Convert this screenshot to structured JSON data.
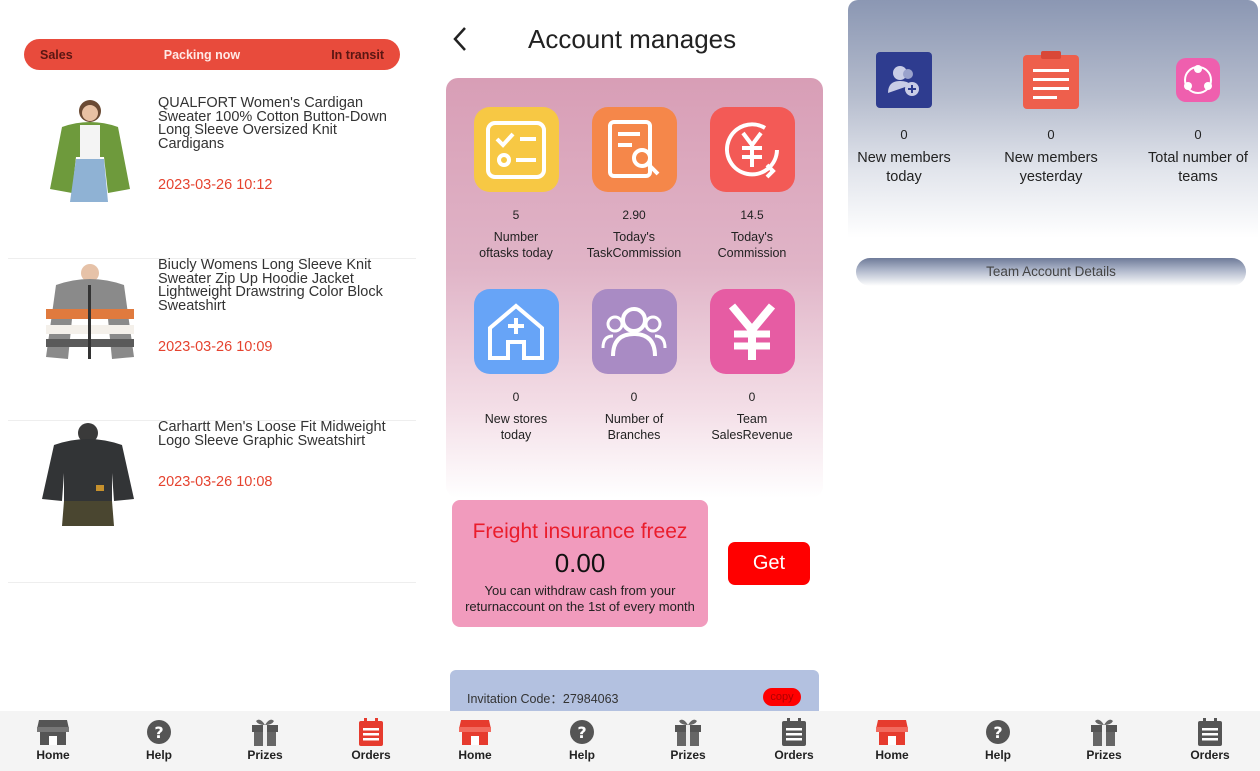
{
  "colors": {
    "accent": "#e84b3c",
    "time_red": "#e5432f",
    "get_button": "#ff0000",
    "freight_bg": "#f19bbd",
    "invite_bg": "#b3c1e0"
  },
  "nav": {
    "items": [
      {
        "label": "Home",
        "icon": "store-icon"
      },
      {
        "label": "Help",
        "icon": "help-icon"
      },
      {
        "label": "Prizes",
        "icon": "gift-icon"
      },
      {
        "label": "Orders",
        "icon": "orders-icon"
      }
    ]
  },
  "orders_panel": {
    "tabs": [
      "Sales",
      "Packing now",
      "In transit"
    ],
    "active_tab": "Packing now",
    "orders": [
      {
        "title": "QUALFORT Women's Cardigan Sweater 100% Cotton Button-Down Long Sleeve Oversized Knit Cardigans",
        "time": "2023-03-26 10:12"
      },
      {
        "title": "Biucly Womens Long Sleeve Knit Sweater Zip Up Hoodie Jacket Lightweight Drawstring Color Block Sweatshirt",
        "time": "2023-03-26 10:09"
      },
      {
        "title": "Carhartt Men's Loose Fit Midweight Logo Sleeve Graphic Sweatshirt",
        "time": "2023-03-26 10:08"
      }
    ]
  },
  "account_panel": {
    "title": "Account manages",
    "stats": [
      {
        "value": "5",
        "label_1": "Number",
        "label_2": "oftasks today",
        "color": "#f7c844",
        "icon": "checklist-icon"
      },
      {
        "value": "2.90",
        "label_1": "Today's",
        "label_2": "TaskCommission",
        "color": "#f5874a",
        "icon": "document-search-icon"
      },
      {
        "value": "14.5",
        "label_1": "Today's",
        "label_2": "Commission",
        "color": "#f35a56",
        "icon": "yuan-refresh-icon"
      },
      {
        "value": "0",
        "label_1": "New stores",
        "label_2": "today",
        "color": "#67a4f7",
        "icon": "house-plus-icon"
      },
      {
        "value": "0",
        "label_1": "Number of",
        "label_2": "Branches",
        "color": "#a98bc4",
        "icon": "users-icon"
      },
      {
        "value": "0",
        "label_1": "Team",
        "label_2": "SalesRevenue",
        "color": "#e65ca3",
        "icon": "yuan-icon"
      }
    ],
    "freight": {
      "title": "Freight insurance freez",
      "value": "0.00",
      "desc_1": "You can withdraw cash from your",
      "desc_2": "returnaccount on the 1st of every month"
    },
    "get_label": "Get",
    "invitation": {
      "label": "Invitation Code：27984063",
      "copy_label": "copy"
    }
  },
  "team_panel": {
    "stats": [
      {
        "value": "0",
        "label_1": "New members",
        "label_2": "today",
        "color": "#2e3c8f",
        "icon": "user-add-icon"
      },
      {
        "value": "0",
        "label_1": "New members",
        "label_2": "yesterday",
        "color": "#ee5f4c",
        "icon": "clipboard-icon"
      },
      {
        "value": "0",
        "label_1": "Total number of",
        "label_2": "teams",
        "color": "#ef5fae",
        "icon": "share-icon"
      }
    ],
    "details_label": "Team Account Details"
  }
}
